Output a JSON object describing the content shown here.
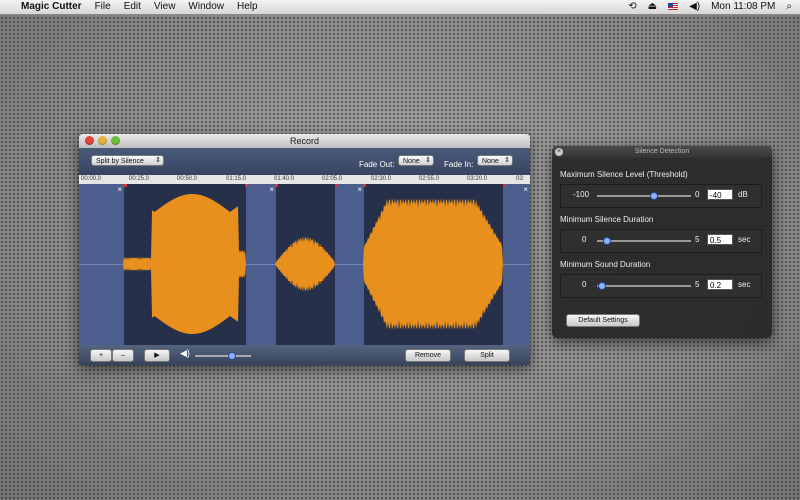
{
  "menubar": {
    "app_name": "Magic Cutter",
    "items": [
      "File",
      "Edit",
      "View",
      "Window",
      "Help"
    ],
    "clock": "Mon 11:08 PM"
  },
  "record_window": {
    "title": "Record",
    "mode_popup": "Split by Silence",
    "fade_out_label": "Fade Out:",
    "fade_out_value": "None",
    "fade_in_label": "Fade In:",
    "fade_in_value": "None",
    "ruler_ticks": [
      "00:00.0",
      "00:25.0",
      "00:50.0",
      "01:15.0",
      "01:40.0",
      "02:05.0",
      "02:30.0",
      "02:55.0",
      "03:20.0",
      "03:"
    ],
    "zoom_in_label": "+",
    "zoom_out_label": "–",
    "play_label": "▶",
    "volume_level": 0.65,
    "remove_label": "Remove",
    "split_label": "Split",
    "waveform_color": "#e8901e"
  },
  "silence_panel": {
    "title": "Silence Detection",
    "threshold": {
      "label": "Maximum Silence Level (Threshold)",
      "min": "-100",
      "max": "0",
      "value": "-40",
      "unit": "dB",
      "level": 0.6
    },
    "silence_duration": {
      "label": "Minimum Silence Duration",
      "min": "0",
      "max": "5",
      "value": "0.5",
      "unit": "sec",
      "level": 0.1
    },
    "sound_duration": {
      "label": "Minimum Sound Duration",
      "min": "0",
      "max": "5",
      "value": "0.2",
      "unit": "sec",
      "level": 0.04
    },
    "default_button": "Default Settings"
  }
}
